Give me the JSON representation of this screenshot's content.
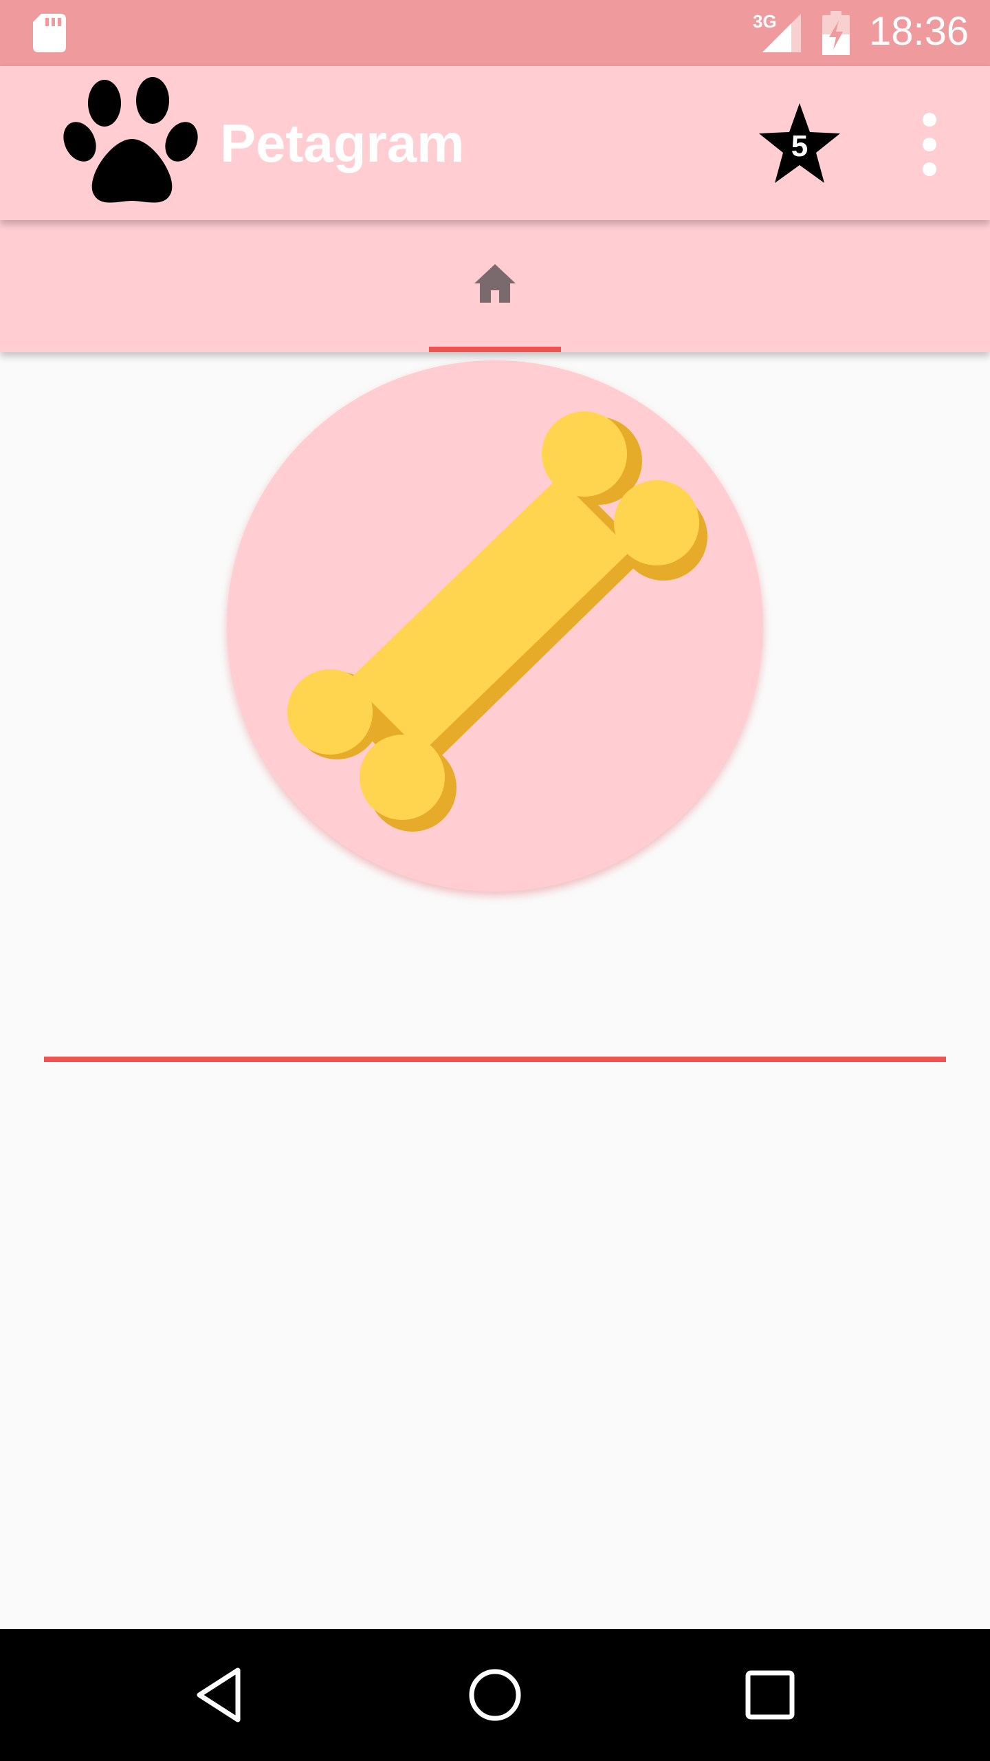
{
  "status_bar": {
    "network": "3G",
    "time": "18:36",
    "icons": [
      "sd-card-icon",
      "signal-icon",
      "battery-charging-icon"
    ]
  },
  "app_bar": {
    "logo_icon": "paw-icon",
    "title": "Petagram",
    "favorites_count": "5",
    "favorites_icon": "star-icon",
    "overflow_icon": "more-vert-icon"
  },
  "tabs": [
    {
      "icon": "home-icon",
      "selected": true
    }
  ],
  "profile": {
    "image": "bone-icon"
  },
  "nav_bar": {
    "icons": [
      "back-icon",
      "home-circle-icon",
      "recents-icon"
    ]
  },
  "colors": {
    "status_bar": "#ef9a9c",
    "app_bar": "#ffcdd2",
    "accent": "#ef5350",
    "background": "#fafafa",
    "bone": "#ffd54f",
    "bone_shadow": "#e6ac29"
  }
}
